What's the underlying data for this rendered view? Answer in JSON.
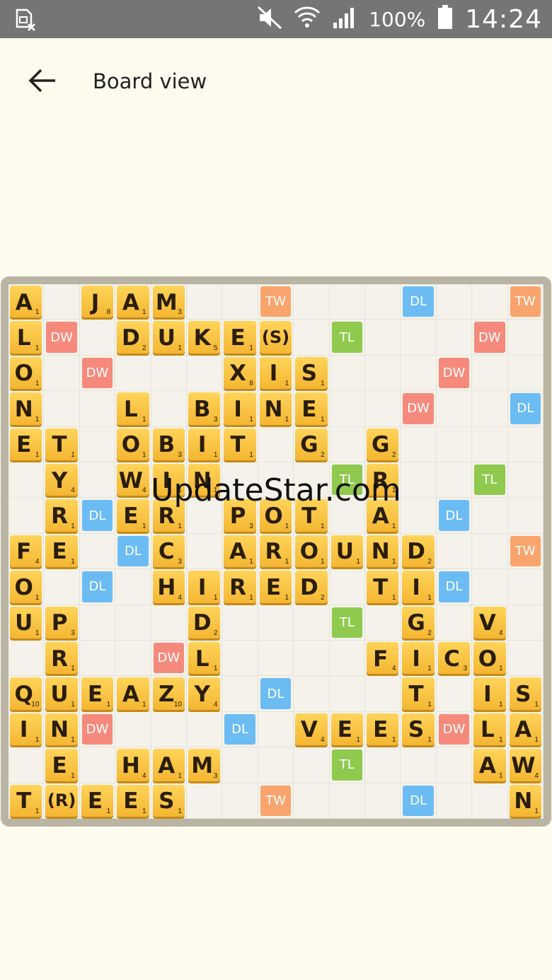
{
  "status_bar": {
    "battery_percent": "100%",
    "time": "14:24"
  },
  "app_bar": {
    "title": "Board view"
  },
  "watermark": "UpdateStar.com",
  "colors": {
    "DW": "#f58a7c",
    "TW": "#f9a46c",
    "DL": "#6cbcf4",
    "TL": "#8fc94e"
  },
  "board": {
    "size": 15,
    "premiums": [
      {
        "r": 0,
        "c": 7,
        "t": "TW"
      },
      {
        "r": 0,
        "c": 11,
        "t": "DL"
      },
      {
        "r": 0,
        "c": 14,
        "t": "TW"
      },
      {
        "r": 1,
        "c": 1,
        "t": "DW"
      },
      {
        "r": 1,
        "c": 9,
        "t": "TL"
      },
      {
        "r": 1,
        "c": 13,
        "t": "DW"
      },
      {
        "r": 2,
        "c": 2,
        "t": "DW"
      },
      {
        "r": 2,
        "c": 12,
        "t": "DW"
      },
      {
        "r": 3,
        "c": 11,
        "t": "DW"
      },
      {
        "r": 3,
        "c": 14,
        "t": "DL"
      },
      {
        "r": 5,
        "c": 9,
        "t": "TL"
      },
      {
        "r": 5,
        "c": 13,
        "t": "TL"
      },
      {
        "r": 6,
        "c": 2,
        "t": "DL"
      },
      {
        "r": 6,
        "c": 12,
        "t": "DL"
      },
      {
        "r": 7,
        "c": 3,
        "t": "DL"
      },
      {
        "r": 7,
        "c": 14,
        "t": "TW"
      },
      {
        "r": 8,
        "c": 2,
        "t": "DL"
      },
      {
        "r": 8,
        "c": 12,
        "t": "DL"
      },
      {
        "r": 9,
        "c": 9,
        "t": "TL"
      },
      {
        "r": 10,
        "c": 4,
        "t": "DW"
      },
      {
        "r": 11,
        "c": 7,
        "t": "DL"
      },
      {
        "r": 12,
        "c": 2,
        "t": "DW"
      },
      {
        "r": 12,
        "c": 6,
        "t": "DL"
      },
      {
        "r": 12,
        "c": 12,
        "t": "DW"
      },
      {
        "r": 13,
        "c": 9,
        "t": "TL"
      },
      {
        "r": 14,
        "c": 7,
        "t": "TW"
      },
      {
        "r": 14,
        "c": 11,
        "t": "DL"
      }
    ],
    "tiles": [
      {
        "r": 0,
        "c": 0,
        "l": "A",
        "p": "1"
      },
      {
        "r": 0,
        "c": 2,
        "l": "J",
        "p": "8"
      },
      {
        "r": 0,
        "c": 3,
        "l": "A",
        "p": "1"
      },
      {
        "r": 0,
        "c": 4,
        "l": "M",
        "p": "3"
      },
      {
        "r": 1,
        "c": 0,
        "l": "L",
        "p": "1"
      },
      {
        "r": 1,
        "c": 3,
        "l": "D",
        "p": "2"
      },
      {
        "r": 1,
        "c": 4,
        "l": "U",
        "p": "1"
      },
      {
        "r": 1,
        "c": 5,
        "l": "K",
        "p": "5"
      },
      {
        "r": 1,
        "c": 6,
        "l": "E",
        "p": "1"
      },
      {
        "r": 1,
        "c": 7,
        "l": "(S)",
        "p": ""
      },
      {
        "r": 2,
        "c": 0,
        "l": "O",
        "p": "1"
      },
      {
        "r": 2,
        "c": 6,
        "l": "X",
        "p": "8"
      },
      {
        "r": 2,
        "c": 7,
        "l": "I",
        "p": "1"
      },
      {
        "r": 2,
        "c": 8,
        "l": "S",
        "p": "1"
      },
      {
        "r": 3,
        "c": 0,
        "l": "N",
        "p": "1"
      },
      {
        "r": 3,
        "c": 3,
        "l": "L",
        "p": "1"
      },
      {
        "r": 3,
        "c": 5,
        "l": "B",
        "p": "3"
      },
      {
        "r": 3,
        "c": 6,
        "l": "I",
        "p": "1"
      },
      {
        "r": 3,
        "c": 7,
        "l": "N",
        "p": "1"
      },
      {
        "r": 3,
        "c": 8,
        "l": "E",
        "p": "1"
      },
      {
        "r": 4,
        "c": 0,
        "l": "E",
        "p": "1"
      },
      {
        "r": 4,
        "c": 1,
        "l": "T",
        "p": "1"
      },
      {
        "r": 4,
        "c": 3,
        "l": "O",
        "p": "1"
      },
      {
        "r": 4,
        "c": 4,
        "l": "B",
        "p": "3"
      },
      {
        "r": 4,
        "c": 5,
        "l": "I",
        "p": "1"
      },
      {
        "r": 4,
        "c": 6,
        "l": "T",
        "p": "1"
      },
      {
        "r": 4,
        "c": 8,
        "l": "G",
        "p": "2"
      },
      {
        "r": 4,
        "c": 10,
        "l": "G",
        "p": "2"
      },
      {
        "r": 5,
        "c": 1,
        "l": "Y",
        "p": "4"
      },
      {
        "r": 5,
        "c": 3,
        "l": "W",
        "p": "4"
      },
      {
        "r": 5,
        "c": 4,
        "l": "I",
        "p": "1"
      },
      {
        "r": 5,
        "c": 5,
        "l": "N",
        "p": "1"
      },
      {
        "r": 5,
        "c": 10,
        "l": "R",
        "p": "1"
      },
      {
        "r": 6,
        "c": 1,
        "l": "R",
        "p": "1"
      },
      {
        "r": 6,
        "c": 3,
        "l": "E",
        "p": "1"
      },
      {
        "r": 6,
        "c": 4,
        "l": "R",
        "p": "1"
      },
      {
        "r": 6,
        "c": 6,
        "l": "P",
        "p": "3"
      },
      {
        "r": 6,
        "c": 7,
        "l": "O",
        "p": "1"
      },
      {
        "r": 6,
        "c": 8,
        "l": "T",
        "p": "1"
      },
      {
        "r": 6,
        "c": 10,
        "l": "A",
        "p": "1"
      },
      {
        "r": 7,
        "c": 0,
        "l": "F",
        "p": "4"
      },
      {
        "r": 7,
        "c": 1,
        "l": "E",
        "p": "1"
      },
      {
        "r": 7,
        "c": 4,
        "l": "C",
        "p": "3"
      },
      {
        "r": 7,
        "c": 6,
        "l": "A",
        "p": "1"
      },
      {
        "r": 7,
        "c": 7,
        "l": "R",
        "p": "1"
      },
      {
        "r": 7,
        "c": 8,
        "l": "O",
        "p": "1"
      },
      {
        "r": 7,
        "c": 9,
        "l": "U",
        "p": "1"
      },
      {
        "r": 7,
        "c": 10,
        "l": "N",
        "p": "1"
      },
      {
        "r": 7,
        "c": 11,
        "l": "D",
        "p": "2"
      },
      {
        "r": 8,
        "c": 0,
        "l": "O",
        "p": "1"
      },
      {
        "r": 8,
        "c": 4,
        "l": "H",
        "p": "4"
      },
      {
        "r": 8,
        "c": 5,
        "l": "I",
        "p": "1"
      },
      {
        "r": 8,
        "c": 6,
        "l": "R",
        "p": "1"
      },
      {
        "r": 8,
        "c": 7,
        "l": "E",
        "p": "1"
      },
      {
        "r": 8,
        "c": 8,
        "l": "D",
        "p": "2"
      },
      {
        "r": 8,
        "c": 10,
        "l": "T",
        "p": "1"
      },
      {
        "r": 8,
        "c": 11,
        "l": "I",
        "p": "1"
      },
      {
        "r": 9,
        "c": 0,
        "l": "U",
        "p": "1"
      },
      {
        "r": 9,
        "c": 1,
        "l": "P",
        "p": "3"
      },
      {
        "r": 9,
        "c": 5,
        "l": "D",
        "p": "2"
      },
      {
        "r": 9,
        "c": 11,
        "l": "G",
        "p": "2"
      },
      {
        "r": 9,
        "c": 13,
        "l": "V",
        "p": "4"
      },
      {
        "r": 10,
        "c": 1,
        "l": "R",
        "p": "1"
      },
      {
        "r": 10,
        "c": 5,
        "l": "L",
        "p": "1"
      },
      {
        "r": 10,
        "c": 10,
        "l": "F",
        "p": "4"
      },
      {
        "r": 10,
        "c": 11,
        "l": "I",
        "p": "1"
      },
      {
        "r": 10,
        "c": 12,
        "l": "C",
        "p": "3"
      },
      {
        "r": 10,
        "c": 13,
        "l": "O",
        "p": "1"
      },
      {
        "r": 11,
        "c": 0,
        "l": "Q",
        "p": "10"
      },
      {
        "r": 11,
        "c": 1,
        "l": "U",
        "p": "1"
      },
      {
        "r": 11,
        "c": 2,
        "l": "E",
        "p": "1"
      },
      {
        "r": 11,
        "c": 3,
        "l": "A",
        "p": "1"
      },
      {
        "r": 11,
        "c": 4,
        "l": "Z",
        "p": "10"
      },
      {
        "r": 11,
        "c": 5,
        "l": "Y",
        "p": "4"
      },
      {
        "r": 11,
        "c": 11,
        "l": "T",
        "p": "1"
      },
      {
        "r": 11,
        "c": 13,
        "l": "I",
        "p": "1"
      },
      {
        "r": 11,
        "c": 14,
        "l": "S",
        "p": "1"
      },
      {
        "r": 12,
        "c": 0,
        "l": "I",
        "p": "1"
      },
      {
        "r": 12,
        "c": 1,
        "l": "N",
        "p": "1"
      },
      {
        "r": 12,
        "c": 8,
        "l": "V",
        "p": "4"
      },
      {
        "r": 12,
        "c": 9,
        "l": "E",
        "p": "1"
      },
      {
        "r": 12,
        "c": 10,
        "l": "E",
        "p": "1"
      },
      {
        "r": 12,
        "c": 11,
        "l": "S",
        "p": "1"
      },
      {
        "r": 12,
        "c": 13,
        "l": "L",
        "p": "1"
      },
      {
        "r": 12,
        "c": 14,
        "l": "A",
        "p": "1"
      },
      {
        "r": 13,
        "c": 1,
        "l": "E",
        "p": "1"
      },
      {
        "r": 13,
        "c": 3,
        "l": "H",
        "p": "4"
      },
      {
        "r": 13,
        "c": 4,
        "l": "A",
        "p": "1"
      },
      {
        "r": 13,
        "c": 5,
        "l": "M",
        "p": "3"
      },
      {
        "r": 13,
        "c": 13,
        "l": "A",
        "p": "1"
      },
      {
        "r": 13,
        "c": 14,
        "l": "W",
        "p": "4"
      },
      {
        "r": 14,
        "c": 0,
        "l": "T",
        "p": "1"
      },
      {
        "r": 14,
        "c": 1,
        "l": "(R)",
        "p": ""
      },
      {
        "r": 14,
        "c": 2,
        "l": "E",
        "p": "1"
      },
      {
        "r": 14,
        "c": 3,
        "l": "E",
        "p": "1"
      },
      {
        "r": 14,
        "c": 4,
        "l": "S",
        "p": "1"
      },
      {
        "r": 14,
        "c": 14,
        "l": "N",
        "p": "1"
      }
    ]
  }
}
